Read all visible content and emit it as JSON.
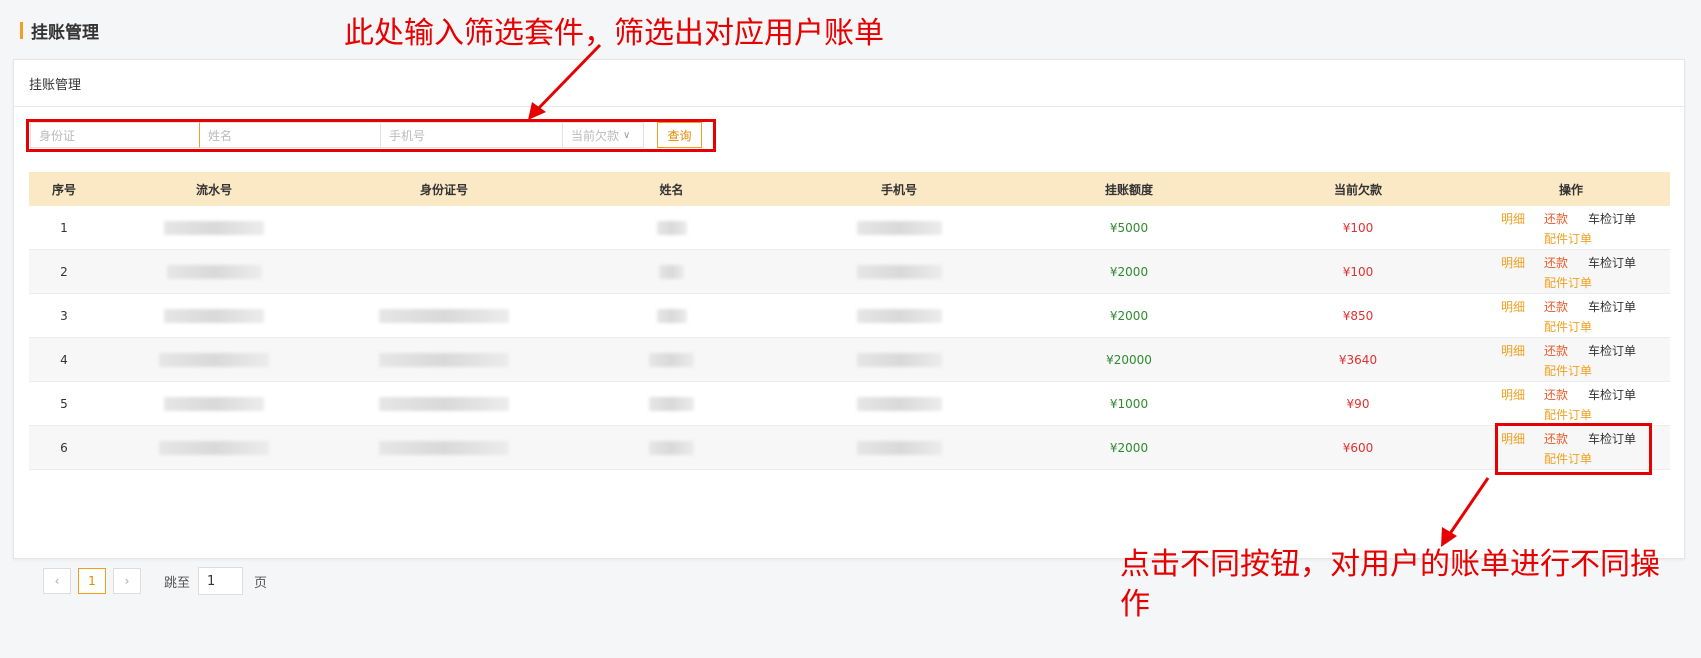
{
  "page_title": "挂账管理",
  "card_title": "挂账管理",
  "filters": {
    "id_placeholder": "身份证",
    "name_placeholder": "姓名",
    "phone_placeholder": "手机号",
    "debt_select": "当前欠款",
    "query_button": "查询"
  },
  "table": {
    "headers": [
      "序号",
      "流水号",
      "身份证号",
      "姓名",
      "手机号",
      "挂账额度",
      "当前欠款",
      "操作"
    ],
    "rows": [
      {
        "no": "1",
        "limit": "¥5000",
        "debt": "¥100"
      },
      {
        "no": "2",
        "limit": "¥2000",
        "debt": "¥100"
      },
      {
        "no": "3",
        "limit": "¥2000",
        "debt": "¥850"
      },
      {
        "no": "4",
        "limit": "¥20000",
        "debt": "¥3640"
      },
      {
        "no": "5",
        "limit": "¥1000",
        "debt": "¥90"
      },
      {
        "no": "6",
        "limit": "¥2000",
        "debt": "¥600"
      }
    ],
    "ops": {
      "detail": "明细",
      "repay": "还款",
      "inspect_order": "车检订单",
      "parts_order": "配件订单"
    }
  },
  "pager": {
    "prev": "‹",
    "current_page": "1",
    "next": "›",
    "jump_label": "跳至",
    "jump_value": "1",
    "page_suffix": "页"
  },
  "annotations": {
    "filter_note": "此处输入筛选套件，筛选出对应用户账单",
    "ops_note": "点击不同按钮，对用户的账单进行不同操作"
  },
  "colors": {
    "accent": "#f0a020",
    "annotation": "#e60000",
    "limit_green": "#2e8b2e",
    "debt_red": "#e03131",
    "header_bg": "#fbe9c5"
  }
}
